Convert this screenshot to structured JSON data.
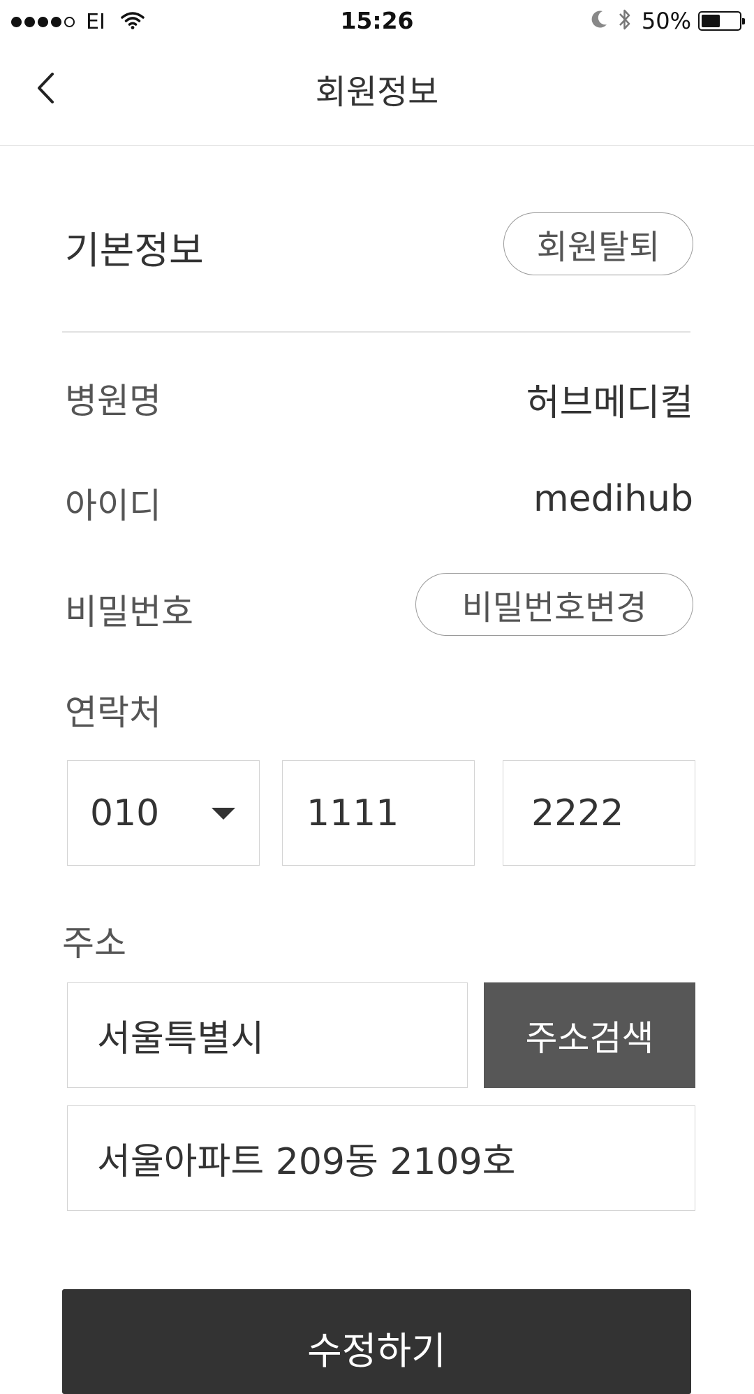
{
  "status_bar": {
    "carrier": "EI",
    "time": "15:26",
    "battery_percent": "50%",
    "battery_level": 0.5,
    "signal_bars": 4,
    "signal_total": 5,
    "icons": [
      "signal-dots-icon",
      "wifi-icon",
      "moon-icon",
      "bluetooth-icon",
      "battery-icon"
    ]
  },
  "nav": {
    "back_icon": "chevron-left-icon",
    "title": "회원정보"
  },
  "basic_info": {
    "title": "기본정보",
    "withdraw_label": "회원탈퇴"
  },
  "rows": {
    "hospital": {
      "label": "병원명",
      "value": "허브메디컬"
    },
    "user_id": {
      "label": "아이디",
      "value": "medihub"
    },
    "password": {
      "label": "비밀번호",
      "button_label": "비밀번호변경"
    }
  },
  "contact": {
    "label": "연락처",
    "prefix": "010",
    "middle": "1111",
    "last": "2222"
  },
  "address": {
    "label": "주소",
    "city": "서울특별시",
    "search_label": "주소검색",
    "detail": "서울아파트 209동 2109호"
  },
  "submit_label": "수정하기",
  "colors": {
    "text_primary": "#333333",
    "text_secondary": "#555555",
    "border": "#d4d4d4",
    "search_button_bg": "#575757",
    "submit_button_bg": "#333333"
  }
}
